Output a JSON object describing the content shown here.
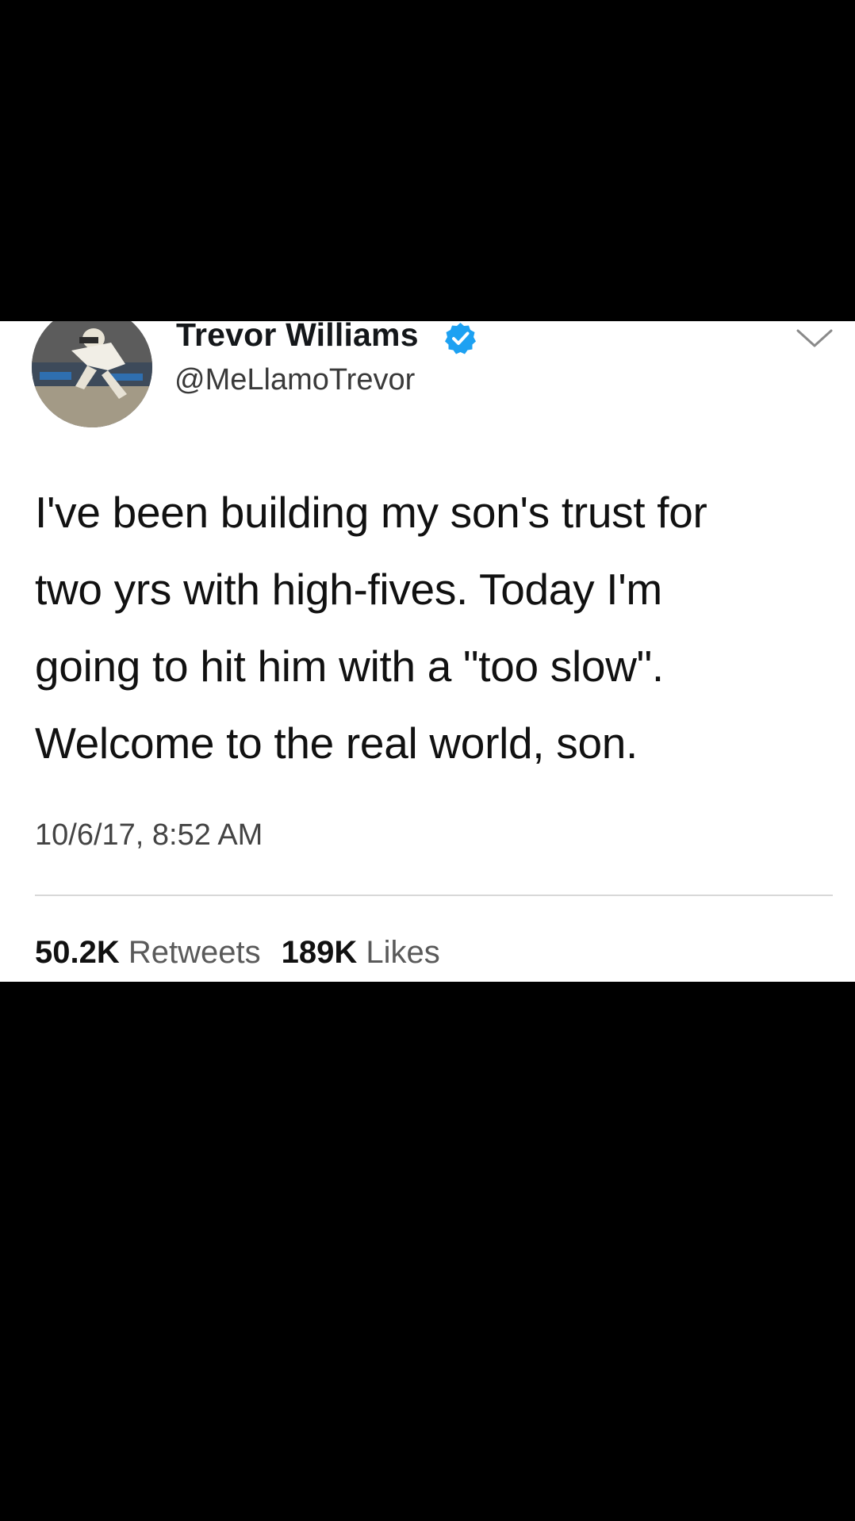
{
  "tweet": {
    "author": {
      "display_name": "Trevor Williams",
      "handle": "@MeLlamoTrevor",
      "verified": true,
      "avatar": "baseball-pitcher-photo"
    },
    "text_lines": [
      "I've been building my son's trust for",
      "two yrs with high-fives. Today I'm",
      "going to hit him with a \"too slow\".",
      "Welcome to the real world, son."
    ],
    "timestamp": "10/6/17, 8:52 AM",
    "stats": {
      "retweets_count": "50.2K",
      "retweets_label": "Retweets",
      "likes_count": "189K",
      "likes_label": "Likes"
    }
  },
  "icons": {
    "verified": "verified-badge-icon",
    "menu": "chevron-down-icon"
  },
  "colors": {
    "background": "#000000",
    "card": "#ffffff",
    "verified_blue": "#1da1f2",
    "text": "#14171a",
    "secondary_text": "#5a5a5a"
  }
}
